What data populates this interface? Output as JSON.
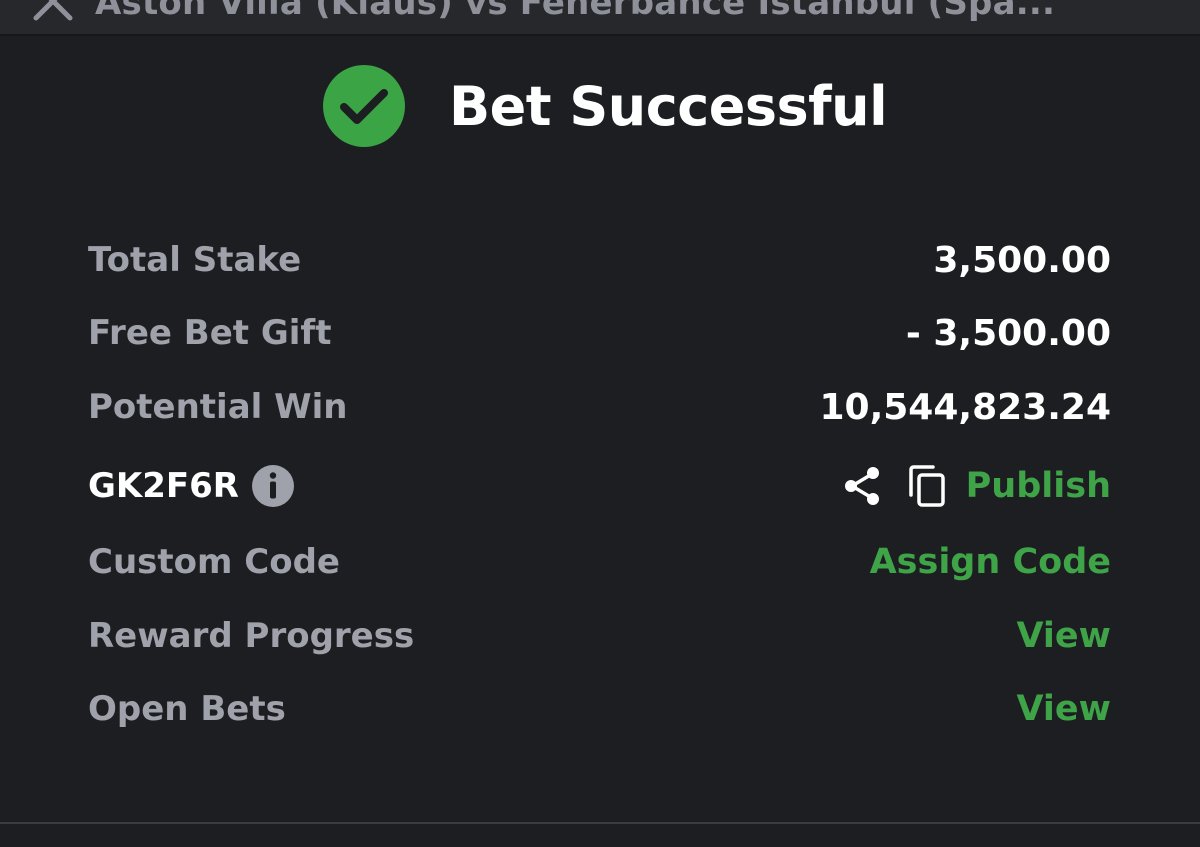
{
  "topbar": {
    "title": "Aston Villa (Klaus) vs Fenerbahce Istanbul (Spa..."
  },
  "header": {
    "title": "Bet Successful",
    "icon": "check-circle-icon",
    "icon_color": "#3ba445"
  },
  "rows": {
    "total_stake": {
      "label": "Total Stake",
      "value": "3,500.00"
    },
    "free_bet_gift": {
      "label": "Free Bet Gift",
      "value": "- 3,500.00"
    },
    "potential_win": {
      "label": "Potential Win",
      "value": "10,544,823.24"
    },
    "booking_code": {
      "code": "GK2F6R",
      "info_icon": "info-icon",
      "share_icon": "share-icon",
      "copy_icon": "copy-icon",
      "action": "Publish"
    },
    "custom_code": {
      "label": "Custom Code",
      "action": "Assign Code"
    },
    "reward_progress": {
      "label": "Reward Progress",
      "action": "View"
    },
    "open_bets": {
      "label": "Open Bets",
      "action": "View"
    }
  },
  "colors": {
    "background": "#1d1e22",
    "accent_green": "#3fa347",
    "label_gray": "#9fa2aa",
    "value_white": "#ffffff"
  }
}
